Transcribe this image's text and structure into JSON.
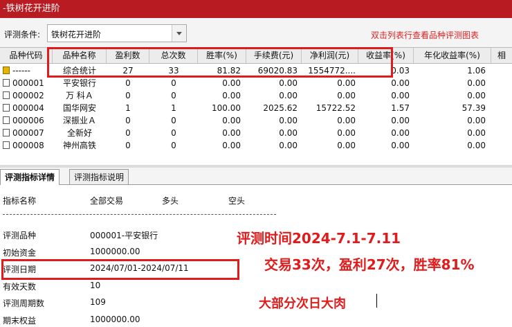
{
  "window": {
    "title": "-铁树花开进阶"
  },
  "condition": {
    "label": "评测条件:",
    "value": "铁树花开进阶",
    "hint": "双击列表行查看品种评测图表"
  },
  "table": {
    "headers": [
      "品种代码",
      "品种名称",
      "盈利数",
      "总次数",
      "胜率(%)",
      "手续费(元)",
      "净利润(元)",
      "收益率(%)",
      "年化收益率(%)",
      "相"
    ],
    "rows": [
      {
        "code": "------",
        "name": "综合统计",
        "profit": "27",
        "total": "33",
        "rate": "81.82",
        "fee": "69020.83",
        "net": "1554772....",
        "ret": "0.03",
        "annual": "1.06",
        "icon": "gold"
      },
      {
        "code": "000001",
        "name": "平安银行",
        "profit": "0",
        "total": "0",
        "rate": "0.00",
        "fee": "0.00",
        "net": "0.00",
        "ret": "0.00",
        "annual": "0.00",
        "icon": "plain"
      },
      {
        "code": "000002",
        "name": "万 科Ａ",
        "profit": "0",
        "total": "0",
        "rate": "0.00",
        "fee": "0.00",
        "net": "0.00",
        "ret": "0.00",
        "annual": "0.00",
        "icon": "plain"
      },
      {
        "code": "000004",
        "name": "国华网安",
        "profit": "1",
        "total": "1",
        "rate": "100.00",
        "fee": "2025.62",
        "net": "15722.52",
        "ret": "1.57",
        "annual": "57.39",
        "icon": "plain"
      },
      {
        "code": "000006",
        "name": "深振业Ａ",
        "profit": "0",
        "total": "0",
        "rate": "0.00",
        "fee": "0.00",
        "net": "0.00",
        "ret": "0.00",
        "annual": "0.00",
        "icon": "plain"
      },
      {
        "code": "000007",
        "name": "全新好",
        "profit": "0",
        "total": "0",
        "rate": "0.00",
        "fee": "0.00",
        "net": "0.00",
        "ret": "0.00",
        "annual": "0.00",
        "icon": "plain"
      },
      {
        "code": "000008",
        "name": "神州高铁",
        "profit": "0",
        "total": "0",
        "rate": "0.00",
        "fee": "0.00",
        "net": "0.00",
        "ret": "0.00",
        "annual": "0.00",
        "icon": "plain"
      }
    ]
  },
  "tabs": [
    "评测指标详情",
    "评测指标说明"
  ],
  "detail": {
    "headers": [
      "指标名称",
      "全部交易",
      "多头",
      "空头"
    ],
    "rows": [
      {
        "label": "评测品种",
        "value": "000001-平安银行"
      },
      {
        "label": "初始资金",
        "value": "1000000.00"
      },
      {
        "label": "评测日期",
        "value": "2024/07/01-2024/07/11"
      },
      {
        "label": "有效天数",
        "value": "10"
      },
      {
        "label": "评测周期数",
        "value": "109"
      },
      {
        "label": "期末权益",
        "value": "1000000.00"
      }
    ]
  },
  "annotations": {
    "line1": "评测时间2024-7.1-7.11",
    "line2": "交易33次，盈利27次，胜率81%",
    "line3": "大部分次日大肉"
  },
  "colors": {
    "title_bar": "#b81c22",
    "annotation": "#e01b1b"
  }
}
